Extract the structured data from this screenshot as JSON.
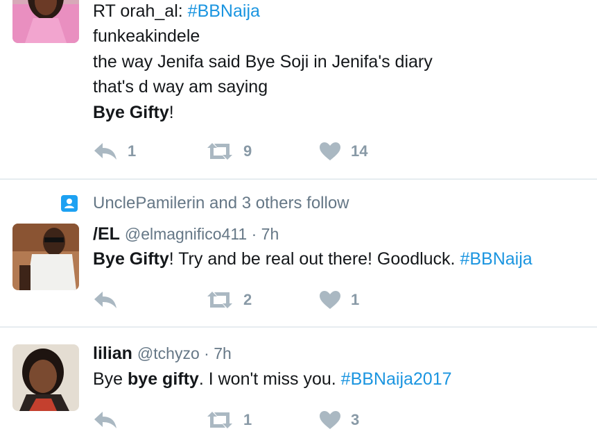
{
  "tweets": [
    {
      "rt_prefix": "RT orah_al: ",
      "rt_hashtag": "#BBNaija",
      "line2": "funkeakindele",
      "line3": "the way Jenifa said Bye Soji in Jenifa's diary",
      "line4": "that's d way am saying",
      "line5_bold": "Bye Gifty",
      "line5_rest": "!",
      "replies": "1",
      "retweets": "9",
      "likes": "14"
    },
    {
      "context": "UnclePamilerin and 3 others follow",
      "name": "/EL",
      "handle": "@elmagnifico411",
      "sep": " · ",
      "time": "7h",
      "text_bold": "Bye Gifty",
      "text_rest": "! Try and be real out there! Goodluck. ",
      "hashtag": "#BBNaija",
      "replies": "",
      "retweets": "2",
      "likes": "1"
    },
    {
      "name": "lilian",
      "handle": "@tchyzo",
      "sep": " · ",
      "time": "7h",
      "text_pre": "Bye ",
      "text_bold": "bye gifty",
      "text_rest": ". I won't miss you. ",
      "hashtag": "#BBNaija2017",
      "replies": "",
      "retweets": "1",
      "likes": "3"
    }
  ],
  "colors": {
    "hashtag": "#1b95e0",
    "meta": "#657786",
    "icon": "#aab8c2",
    "divider": "#e6ecf0"
  },
  "icons": [
    "reply-icon",
    "retweet-icon",
    "like-icon",
    "follow-context-icon",
    "avatar"
  ]
}
